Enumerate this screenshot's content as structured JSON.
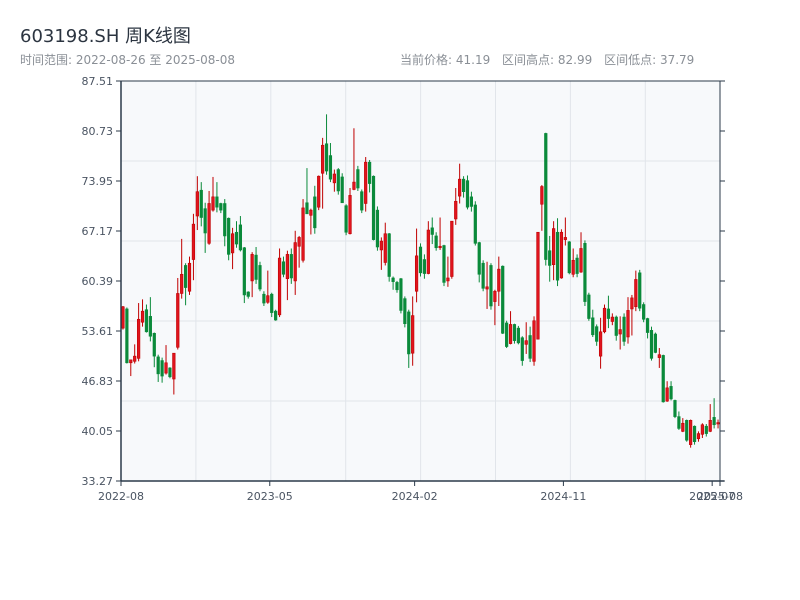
{
  "header": {
    "title": "603198.SH 周K线图",
    "range_label": "时间范围: 2022-08-26 至 2025-08-08",
    "current_price": "当前价格: 41.19",
    "period_high": "区间高点: 82.99",
    "period_low": "区间低点: 37.79"
  },
  "colors": {
    "up": "#e0141e",
    "up_border": "#c00000",
    "down": "#0a8a3a",
    "axis": "#2b3a4a",
    "grid": "#e1e5ea",
    "plot_bg": "#f7f9fb"
  },
  "chart_data": {
    "type": "candlestick",
    "title": "603198.SH 周K线图",
    "interval": "weekly",
    "start_date": "2022-08-26",
    "end_date": "2025-08-08",
    "ylim": [
      33.27,
      87.51
    ],
    "yticks": [
      "33.27",
      "40.05",
      "46.83",
      "53.61",
      "60.39",
      "67.17",
      "73.95",
      "80.73",
      "87.51"
    ],
    "xticks": [
      {
        "label": "2022-08",
        "week_index": 0
      },
      {
        "label": "2023-05",
        "week_index": 38
      },
      {
        "label": "2024-02",
        "week_index": 75
      },
      {
        "label": "2024-11",
        "week_index": 113
      },
      {
        "label": "2025-07",
        "week_index": 151
      },
      {
        "label": "2025-08",
        "week_index": 153
      }
    ],
    "grid": true,
    "up_color_convention": "red up, green down",
    "ohlc": [
      [
        54.0,
        57.0,
        53.8,
        56.9
      ],
      [
        56.6,
        56.8,
        49.2,
        49.3
      ],
      [
        49.3,
        49.6,
        47.5,
        49.7
      ],
      [
        49.5,
        51.8,
        49.2,
        50.2
      ],
      [
        49.9,
        57.4,
        49.5,
        55.2
      ],
      [
        54.8,
        57.9,
        54.2,
        56.3
      ],
      [
        56.5,
        57.2,
        53.4,
        53.5
      ],
      [
        55.6,
        58.2,
        52.2,
        52.9
      ],
      [
        53.3,
        53.4,
        48.7,
        50.2
      ],
      [
        50.1,
        50.4,
        46.7,
        47.8
      ],
      [
        49.6,
        50.0,
        46.6,
        47.5
      ],
      [
        47.9,
        51.7,
        47.7,
        49.3
      ],
      [
        48.6,
        48.7,
        47.2,
        47.4
      ],
      [
        47.1,
        50.6,
        45.0,
        50.6
      ],
      [
        51.4,
        60.8,
        51.1,
        58.7
      ],
      [
        58.7,
        66.1,
        58.0,
        61.3
      ],
      [
        62.5,
        62.8,
        57.1,
        59.5
      ],
      [
        59.0,
        63.7,
        58.5,
        62.8
      ],
      [
        63.3,
        69.5,
        60.5,
        68.1
      ],
      [
        69.2,
        74.6,
        67.3,
        72.5
      ],
      [
        72.7,
        73.8,
        67.8,
        69.0
      ],
      [
        70.2,
        71.0,
        64.2,
        66.9
      ],
      [
        65.5,
        72.6,
        65.3,
        70.9
      ],
      [
        70.0,
        74.5,
        69.8,
        71.8
      ],
      [
        71.8,
        73.8,
        69.7,
        70.4
      ],
      [
        70.9,
        71.0,
        69.6,
        70.0
      ],
      [
        70.9,
        71.5,
        65.1,
        66.5
      ],
      [
        68.9,
        69.0,
        63.2,
        64.0
      ],
      [
        64.2,
        67.6,
        62.0,
        66.8
      ],
      [
        67.0,
        68.5,
        64.9,
        65.4
      ],
      [
        68.0,
        69.2,
        64.4,
        64.6
      ],
      [
        64.9,
        65.0,
        57.4,
        58.5
      ],
      [
        58.9,
        59.0,
        58.0,
        58.3
      ],
      [
        60.4,
        64.3,
        58.2,
        64.0
      ],
      [
        63.9,
        65.0,
        60.0,
        60.6
      ],
      [
        62.5,
        63.0,
        59.0,
        59.3
      ],
      [
        58.6,
        59.0,
        57.0,
        57.4
      ],
      [
        57.5,
        61.8,
        57.3,
        58.4
      ],
      [
        58.6,
        58.8,
        55.5,
        56.1
      ],
      [
        56.3,
        56.5,
        55.0,
        55.1
      ],
      [
        55.8,
        64.8,
        55.5,
        63.5
      ],
      [
        63.0,
        63.7,
        60.9,
        61.3
      ],
      [
        60.7,
        64.5,
        57.8,
        64.0
      ],
      [
        64.0,
        64.8,
        60.0,
        60.8
      ],
      [
        60.4,
        67.2,
        58.5,
        65.6
      ],
      [
        65.1,
        66.5,
        62.2,
        66.3
      ],
      [
        63.2,
        71.5,
        62.9,
        70.3
      ],
      [
        71.0,
        75.7,
        69.5,
        69.5
      ],
      [
        69.3,
        70.2,
        66.7,
        70.0
      ],
      [
        71.8,
        73.3,
        66.8,
        67.6
      ],
      [
        70.4,
        74.7,
        70.0,
        74.6
      ],
      [
        75.0,
        79.8,
        70.2,
        78.8
      ],
      [
        79.0,
        82.99,
        74.8,
        75.3
      ],
      [
        77.4,
        79.1,
        73.8,
        74.2
      ],
      [
        73.7,
        75.5,
        72.5,
        74.9
      ],
      [
        75.5,
        75.7,
        72.1,
        72.6
      ],
      [
        74.5,
        75.0,
        71.0,
        71.0
      ],
      [
        70.6,
        70.8,
        66.6,
        67.0
      ],
      [
        66.8,
        73.0,
        66.7,
        72.0
      ],
      [
        72.8,
        81.1,
        72.7,
        73.8
      ],
      [
        75.5,
        76.0,
        72.6,
        73.0
      ],
      [
        72.5,
        72.8,
        69.6,
        70.0
      ],
      [
        70.9,
        77.2,
        69.8,
        76.5
      ],
      [
        76.5,
        76.8,
        72.4,
        73.6
      ],
      [
        74.6,
        74.7,
        65.9,
        66.0
      ],
      [
        70.0,
        70.5,
        64.5,
        65.0
      ],
      [
        64.6,
        66.3,
        61.9,
        65.8
      ],
      [
        62.9,
        68.3,
        62.5,
        66.8
      ],
      [
        66.8,
        66.9,
        60.3,
        61.0
      ],
      [
        60.8,
        61.0,
        59.2,
        60.3
      ],
      [
        60.2,
        60.4,
        58.8,
        59.2
      ],
      [
        60.7,
        60.8,
        56.0,
        56.4
      ],
      [
        58.0,
        58.3,
        54.1,
        54.6
      ],
      [
        56.2,
        56.5,
        48.6,
        50.5
      ],
      [
        50.6,
        58.3,
        48.9,
        55.7
      ],
      [
        59.0,
        67.5,
        57.5,
        63.8
      ],
      [
        65.0,
        65.5,
        61.0,
        61.5
      ],
      [
        63.3,
        64.0,
        60.7,
        61.4
      ],
      [
        61.4,
        68.5,
        61.3,
        67.3
      ],
      [
        67.6,
        69.0,
        65.4,
        66.7
      ],
      [
        66.5,
        67.0,
        64.5,
        64.9
      ],
      [
        64.9,
        69.0,
        64.6,
        65.1
      ],
      [
        65.2,
        65.3,
        59.7,
        60.2
      ],
      [
        60.4,
        63.7,
        59.6,
        60.8
      ],
      [
        61.0,
        68.5,
        60.7,
        68.5
      ],
      [
        68.8,
        73.0,
        68.0,
        71.2
      ],
      [
        71.9,
        76.3,
        70.9,
        74.2
      ],
      [
        74.2,
        74.6,
        71.7,
        72.5
      ],
      [
        74.0,
        74.7,
        70.1,
        70.4
      ],
      [
        71.8,
        72.5,
        69.8,
        70.5
      ],
      [
        70.7,
        71.2,
        65.2,
        65.5
      ],
      [
        65.6,
        65.7,
        60.2,
        61.3
      ],
      [
        62.8,
        63.2,
        59.0,
        59.4
      ],
      [
        59.3,
        63.0,
        56.6,
        59.6
      ],
      [
        62.5,
        62.8,
        56.5,
        57.0
      ],
      [
        57.6,
        59.2,
        54.4,
        59.0
      ],
      [
        59.0,
        63.7,
        57.0,
        62.0
      ],
      [
        62.4,
        62.5,
        53.2,
        53.3
      ],
      [
        54.7,
        55.0,
        51.3,
        51.5
      ],
      [
        51.9,
        56.3,
        51.8,
        54.5
      ],
      [
        54.5,
        54.6,
        51.9,
        52.3
      ],
      [
        54.0,
        54.3,
        51.8,
        52.0
      ],
      [
        52.7,
        52.9,
        48.9,
        49.6
      ],
      [
        51.8,
        54.8,
        50.5,
        52.3
      ],
      [
        53.0,
        54.2,
        49.4,
        49.9
      ],
      [
        49.5,
        55.6,
        48.9,
        55.0
      ],
      [
        52.5,
        67.0,
        52.5,
        67.0
      ],
      [
        70.8,
        73.4,
        67.2,
        73.2
      ],
      [
        80.4,
        80.5,
        62.5,
        63.3
      ],
      [
        64.5,
        66.5,
        60.3,
        62.5
      ],
      [
        62.6,
        68.5,
        60.5,
        67.5
      ],
      [
        67.0,
        68.9,
        59.7,
        60.5
      ],
      [
        60.8,
        67.4,
        60.7,
        67.0
      ],
      [
        66.0,
        69.0,
        65.2,
        66.3
      ],
      [
        65.7,
        65.8,
        61.3,
        61.5
      ],
      [
        61.3,
        64.8,
        60.9,
        63.2
      ],
      [
        63.5,
        64.0,
        60.9,
        61.4
      ],
      [
        61.6,
        67.0,
        61.5,
        64.8
      ],
      [
        65.5,
        65.9,
        57.0,
        57.6
      ],
      [
        58.5,
        58.8,
        55.0,
        55.3
      ],
      [
        55.4,
        56.5,
        52.8,
        53.1
      ],
      [
        54.2,
        54.5,
        51.6,
        52.2
      ],
      [
        50.2,
        55.4,
        48.5,
        53.5
      ],
      [
        53.5,
        57.2,
        53.3,
        56.7
      ],
      [
        56.6,
        58.4,
        54.0,
        55.3
      ],
      [
        54.9,
        56.0,
        54.4,
        55.5
      ],
      [
        55.5,
        55.7,
        52.3,
        53.0
      ],
      [
        53.2,
        55.6,
        51.1,
        53.8
      ],
      [
        55.5,
        56.0,
        51.6,
        52.2
      ],
      [
        52.8,
        58.2,
        51.9,
        56.4
      ],
      [
        56.6,
        58.5,
        53.0,
        58.1
      ],
      [
        56.9,
        61.8,
        56.3,
        60.6
      ],
      [
        61.5,
        61.9,
        56.3,
        56.7
      ],
      [
        57.2,
        57.5,
        54.8,
        55.2
      ],
      [
        55.3,
        55.4,
        52.6,
        53.4
      ],
      [
        53.7,
        54.2,
        49.6,
        49.9
      ],
      [
        53.2,
        53.4,
        50.6,
        50.7
      ],
      [
        50.0,
        51.3,
        48.6,
        50.4
      ],
      [
        50.3,
        50.4,
        43.9,
        44.0
      ],
      [
        44.1,
        46.8,
        44.0,
        45.9
      ],
      [
        46.1,
        46.8,
        44.2,
        44.4
      ],
      [
        44.2,
        44.3,
        41.8,
        42.0
      ],
      [
        42.0,
        42.7,
        40.2,
        40.4
      ],
      [
        40.0,
        41.8,
        39.9,
        41.1
      ],
      [
        41.5,
        41.6,
        38.6,
        38.8
      ],
      [
        38.2,
        41.6,
        37.79,
        41.5
      ],
      [
        40.7,
        40.8,
        38.2,
        38.6
      ],
      [
        39.0,
        40.0,
        38.6,
        39.7
      ],
      [
        39.6,
        41.1,
        39.1,
        40.9
      ],
      [
        40.7,
        41.0,
        39.3,
        39.7
      ],
      [
        40.0,
        43.7,
        39.9,
        41.5
      ],
      [
        41.9,
        44.5,
        40.4,
        40.9
      ],
      [
        41.0,
        41.6,
        40.4,
        41.19
      ]
    ]
  }
}
